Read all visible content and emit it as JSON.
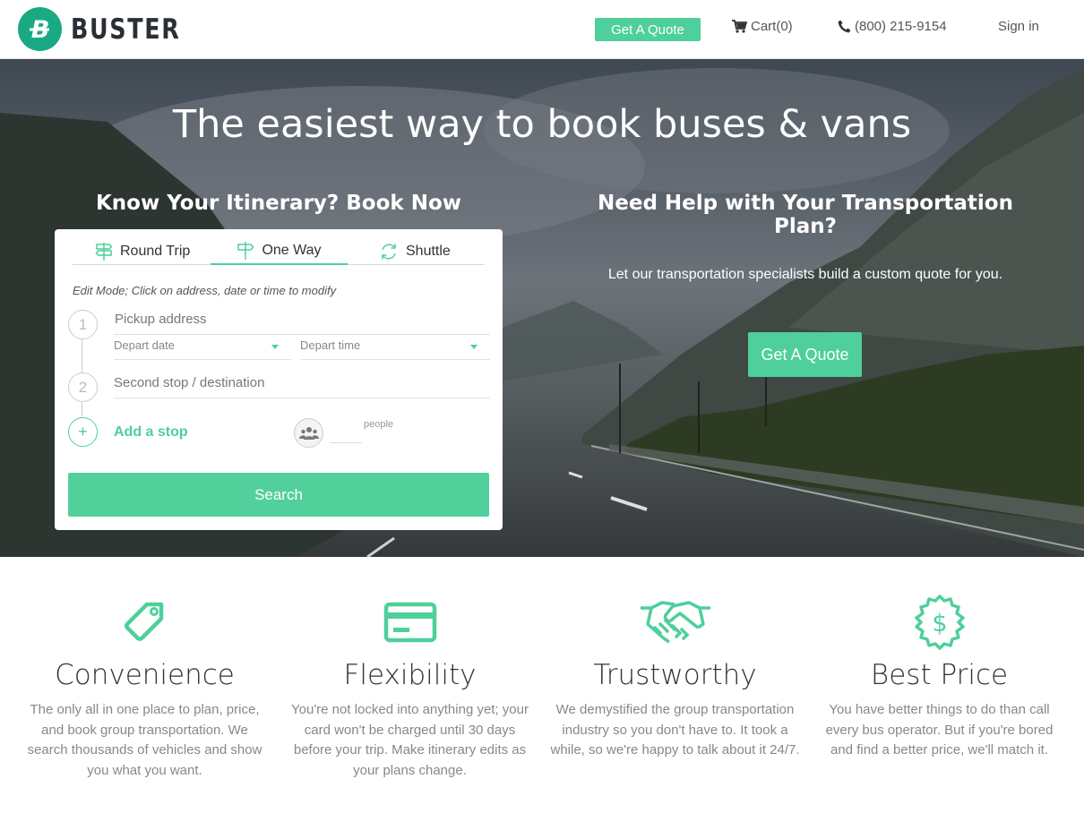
{
  "header": {
    "brand": "BUSTER",
    "logo_letter": "B",
    "quote_label": "Get A Quote",
    "cart_label": "Cart(0)",
    "phone_label": "(800) 215-9154",
    "signin_label": "Sign in"
  },
  "hero": {
    "title": "The easiest way to book buses & vans",
    "left_heading": "Know Your Itinerary? Book Now",
    "right_heading": "Need Help with Your Transportation Plan?",
    "right_subtext": "Let our transportation specialists build a custom quote for you.",
    "quote_button": "Get A Quote"
  },
  "booking": {
    "tabs": [
      {
        "label": "Round Trip",
        "icon": "signpost-icon",
        "active": false
      },
      {
        "label": "One Way",
        "icon": "signpost-icon",
        "active": true
      },
      {
        "label": "Shuttle",
        "icon": "refresh-icon",
        "active": false
      }
    ],
    "edit_note": "Edit Mode; Click on address, date or time to modify",
    "step1": "1",
    "step2": "2",
    "add_step": "+",
    "pickup_placeholder": "Pickup address",
    "depart_date_placeholder": "Depart date",
    "depart_time_placeholder": "Depart time",
    "second_stop_placeholder": "Second stop / destination",
    "add_stop_label": "Add a stop",
    "people_label": "people",
    "people_value": "",
    "search_label": "Search"
  },
  "features": [
    {
      "icon": "tag-icon",
      "title": "Convenience",
      "description": "The only all in one place to plan, price, and book group transportation. We search thousands of vehicles and show you what you want."
    },
    {
      "icon": "credit-card-icon",
      "title": "Flexibility",
      "description": "You're not locked into anything yet; your card won't be charged until 30 days before your trip. Make itinerary edits as your plans change."
    },
    {
      "icon": "handshake-icon",
      "title": "Trustworthy",
      "description": "We demystified the group transportation industry so you don't have to. It took a while, so we're happy to talk about it 24/7."
    },
    {
      "icon": "dollar-badge-icon",
      "title": "Best Price",
      "description": "You have better things to do than call every bus operator. But if you're bored and find a better price, we'll match it."
    }
  ],
  "colors": {
    "accent": "#4ecf9b",
    "logo": "#1aa982",
    "text_dark": "#333333",
    "text_muted": "#888888"
  }
}
